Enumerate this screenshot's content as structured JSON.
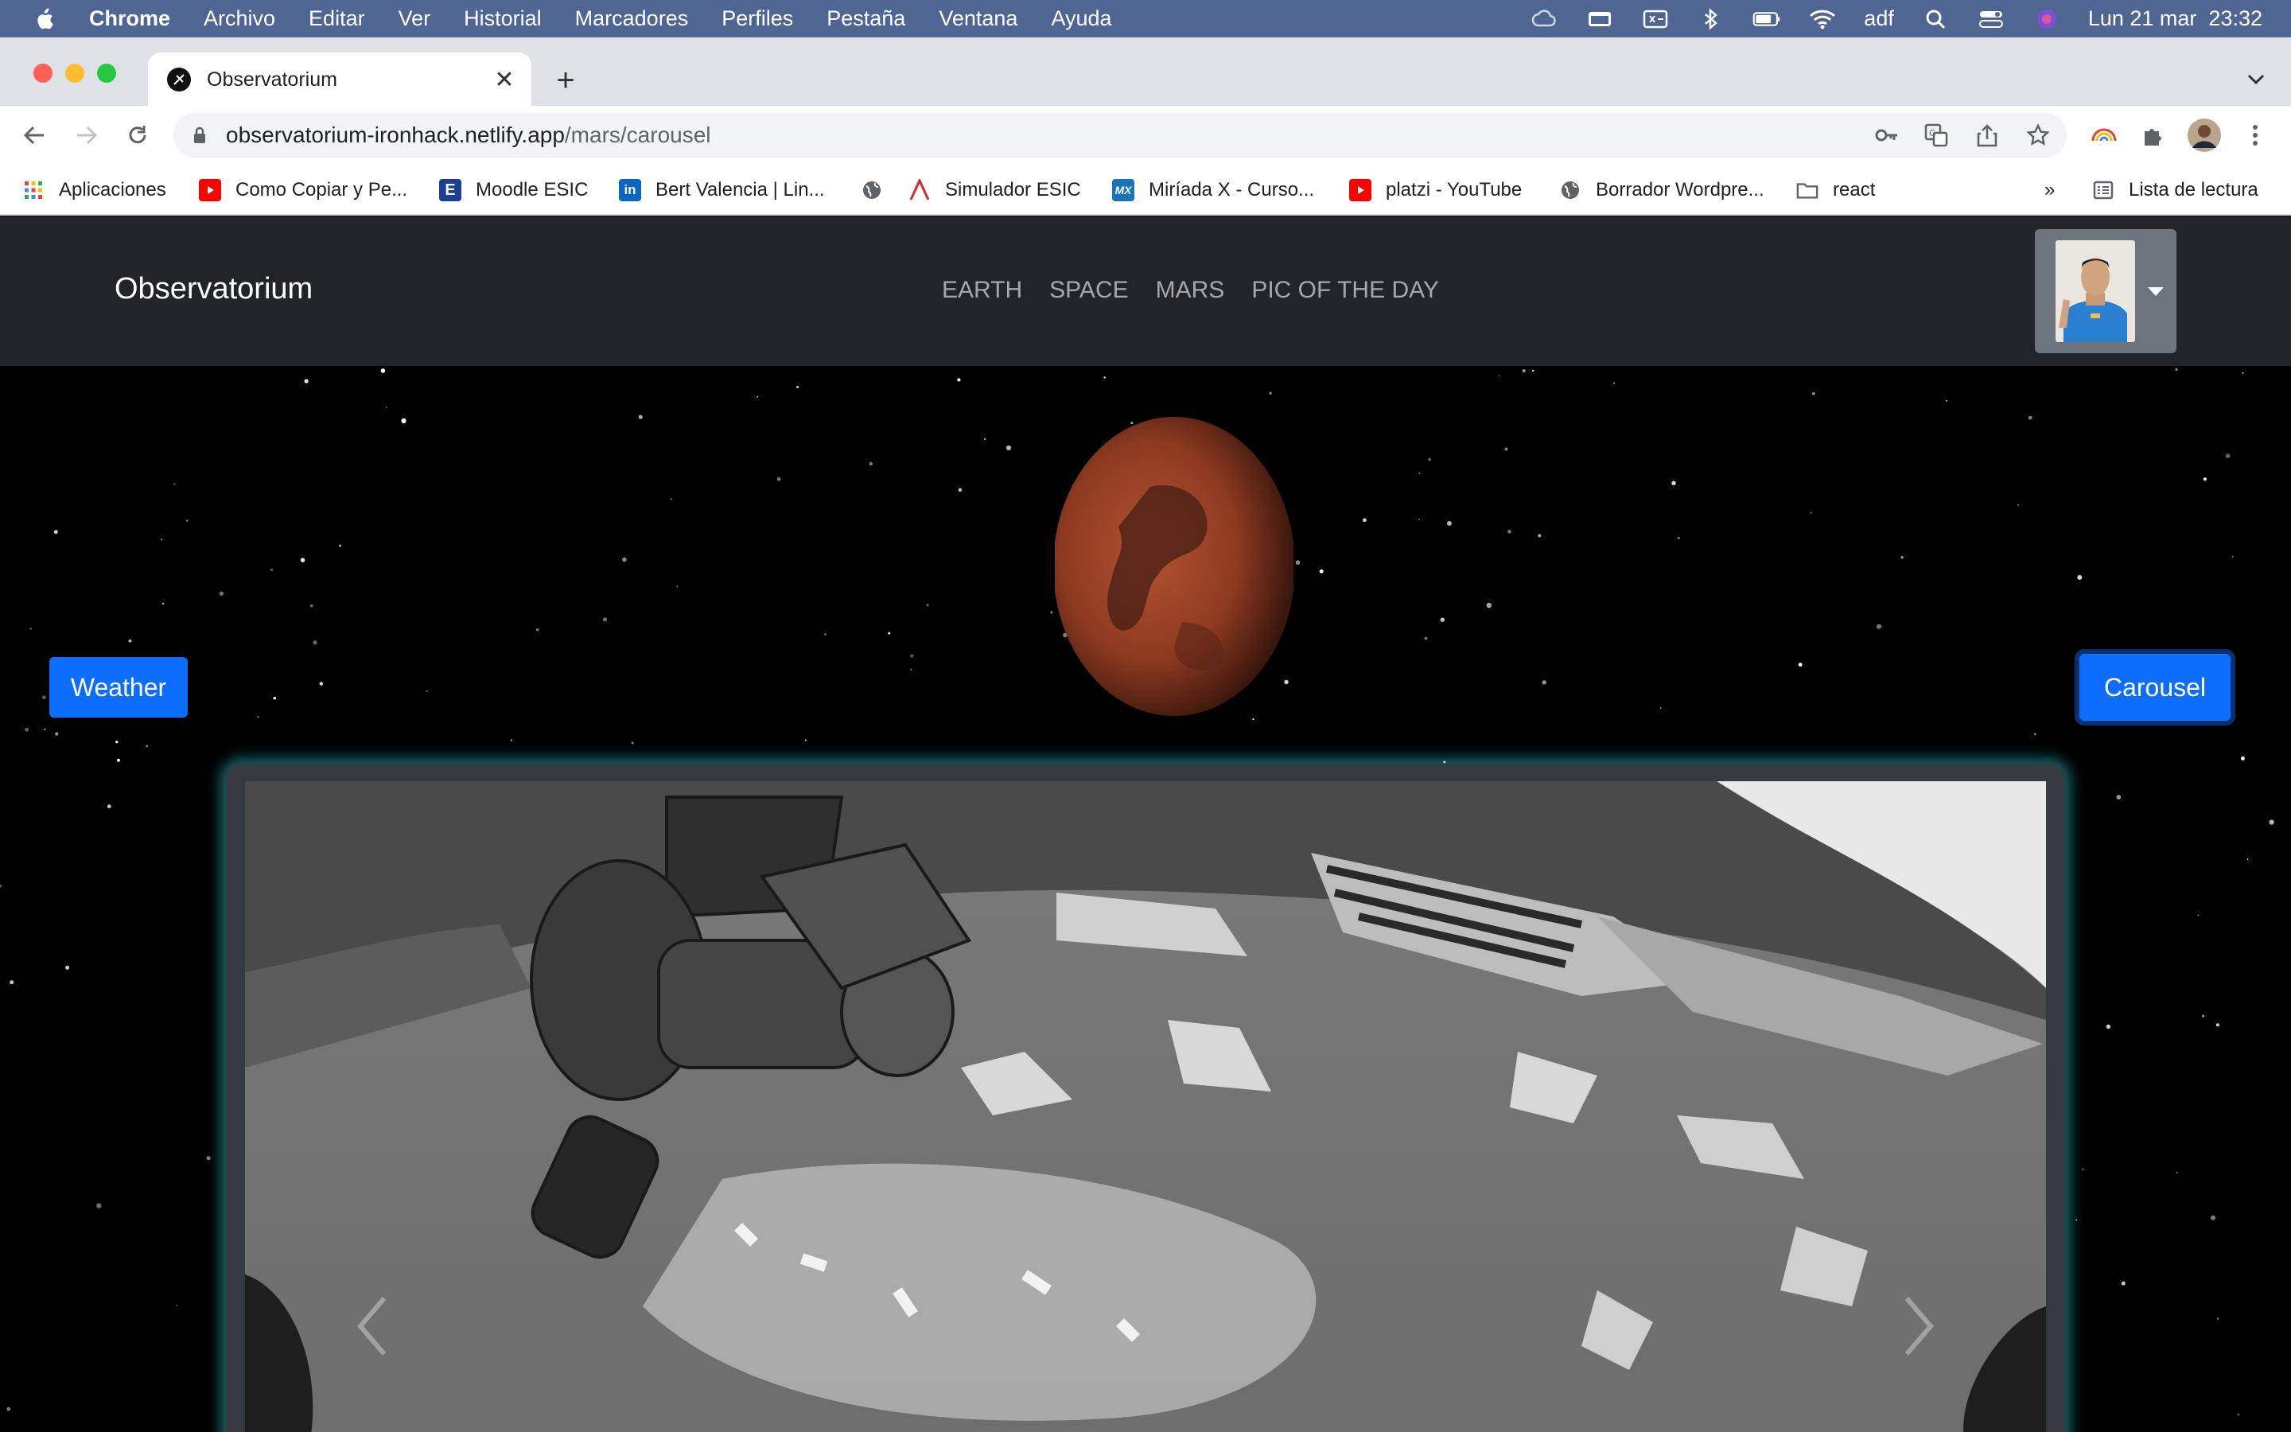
{
  "menubar": {
    "app": "Chrome",
    "items": [
      "Archivo",
      "Editar",
      "Ver",
      "Historial",
      "Marcadores",
      "Perfiles",
      "Pestaña",
      "Ventana",
      "Ayuda"
    ],
    "user": "adf",
    "datetime": "Lun 21 mar  23:32"
  },
  "browser": {
    "tab_title": "Observatorium",
    "url_host": "observatorium-ironhack.netlify.app",
    "url_path": "/mars/carousel",
    "bookmarks": [
      "Aplicaciones",
      "Como Copiar y Pe...",
      "Moodle ESIC",
      "Bert Valencia | Lin...",
      "",
      "Simulador ESIC",
      "Miríada X - Curso...",
      "platzi - YouTube",
      "Borrador Wordpre...",
      "react"
    ],
    "more": "»",
    "reading_list": "Lista de lectura"
  },
  "site": {
    "brand": "Observatorium",
    "nav": [
      "EARTH",
      "SPACE",
      "MARS",
      "PIC OF THE DAY"
    ],
    "weather_button": "Weather",
    "carousel_button": "Carousel"
  },
  "colors": {
    "primary": "#0d6efd",
    "navbar": "#212529",
    "frame_glow": "#32c8d2",
    "menubar": "#4f6592"
  }
}
